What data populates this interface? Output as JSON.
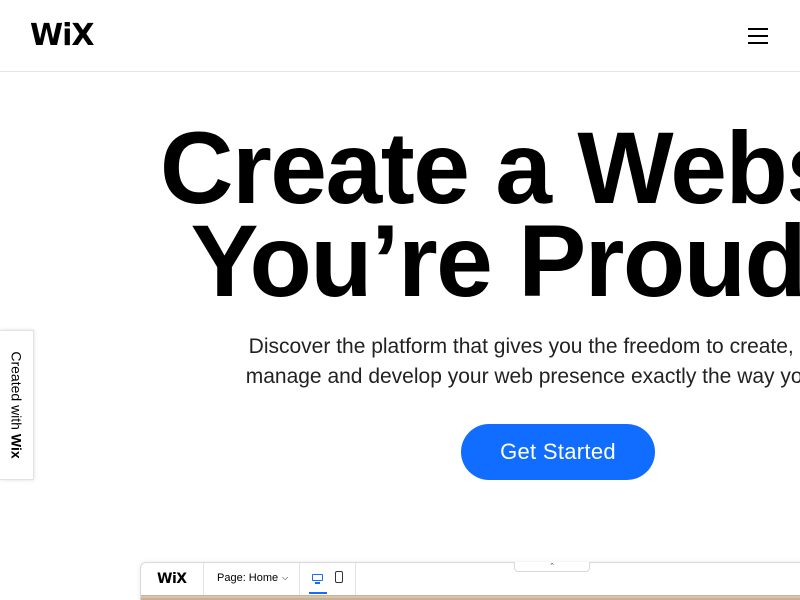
{
  "header": {
    "logo": "WiX",
    "menu_icon": "hamburger-menu-icon"
  },
  "hero": {
    "headline_line1": "Create a Website",
    "headline_line2": "You’re Proud of",
    "subtext_line1": "Discover the platform that gives you the freedom to create, design,",
    "subtext_line2": "manage and develop your web presence exactly the way you want.",
    "cta_label": "Get Started",
    "cta_color": "#116dff"
  },
  "side_badge": {
    "prefix": "Created with ",
    "brand": "Wix"
  },
  "editor_preview": {
    "logo": "WiX",
    "page_selector": "Page: Home",
    "chevron_icon": "chevron-down-icon",
    "desktop_icon": "desktop-icon",
    "mobile_icon": "mobile-icon",
    "handle_glyph": "⌃",
    "canvas_color": "#d7c3ac"
  }
}
